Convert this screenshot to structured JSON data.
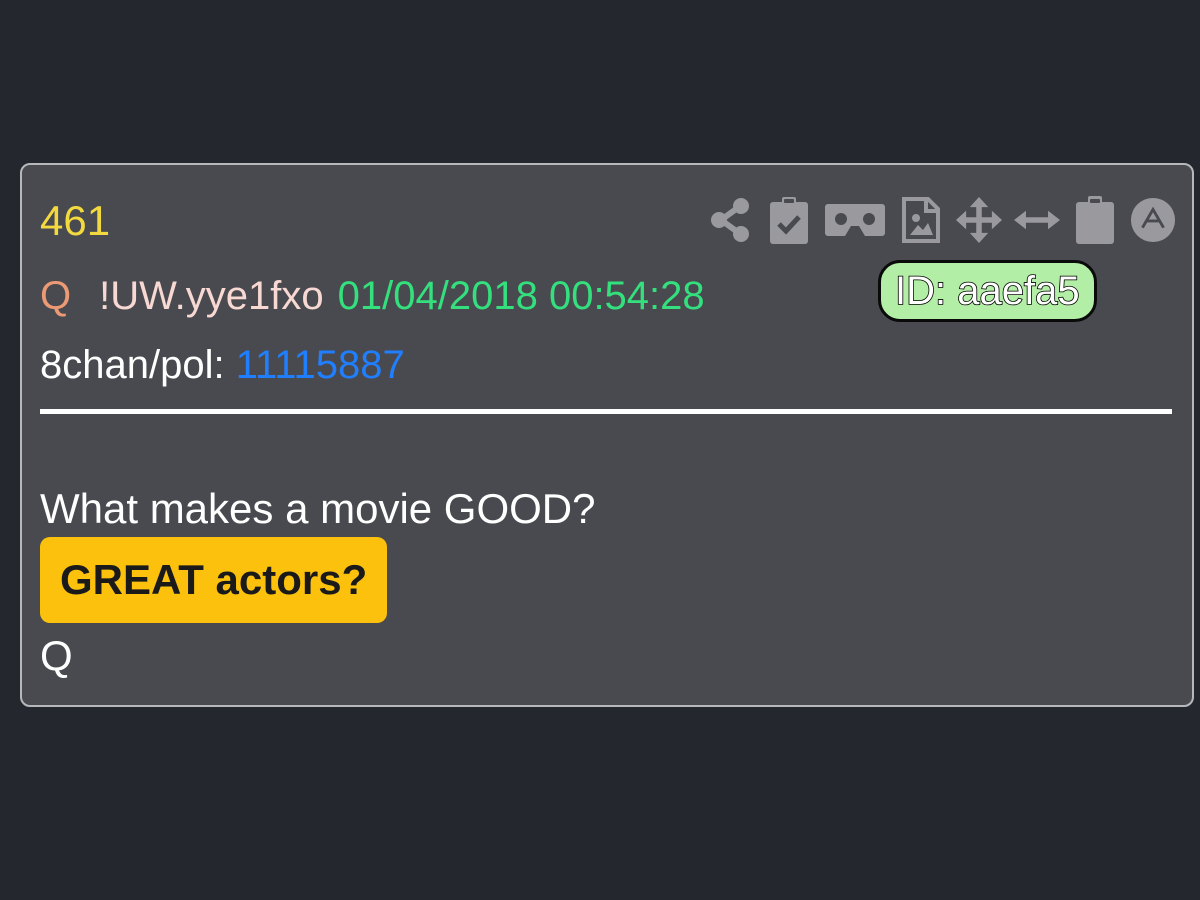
{
  "post": {
    "number": "461",
    "author": "Q",
    "tripcode": "!UW.yye1fxo",
    "timestamp": "01/04/2018 00:54:28",
    "id_badge": "ID: aaefa5",
    "source_label": "8chan/pol: ",
    "source_link": "11115887",
    "message_line": "What makes a movie GOOD?",
    "highlight": "GREAT actors?",
    "signature": "Q"
  },
  "toolbar": {
    "icons": [
      "share-icon",
      "clipboard-check-icon",
      "vr-headset-icon",
      "image-file-icon",
      "move-arrows-icon",
      "horizontal-resize-icon",
      "clipboard-icon",
      "auto-letter-icon"
    ]
  },
  "colors": {
    "background": "#25272f",
    "card": "#494a4f",
    "post_number": "#f2d93f",
    "author": "#ec9a74",
    "tripcode": "#f7d8d3",
    "timestamp": "#33e07d",
    "id_badge_fill": "#b2eea5",
    "source_link": "#1f7fff",
    "highlight": "#fcc10c",
    "icons": "#9a9a9e"
  }
}
